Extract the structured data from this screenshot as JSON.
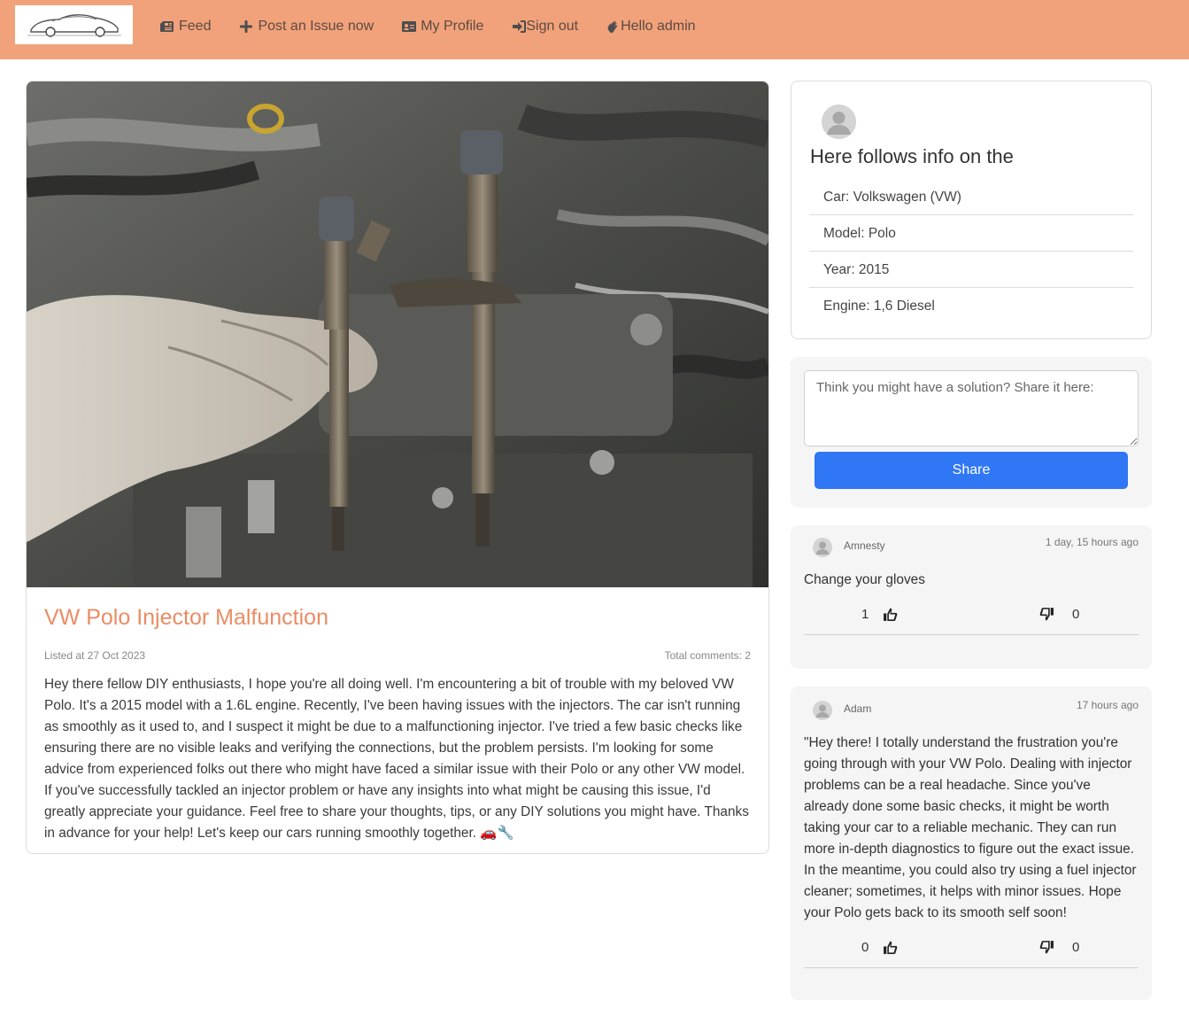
{
  "nav": {
    "links": [
      {
        "label": "Feed",
        "icon": "newspaper-icon"
      },
      {
        "label": "Post an Issue now",
        "icon": "plus-icon"
      },
      {
        "label": "My Profile",
        "icon": "id-card-icon"
      },
      {
        "label": "Sign out",
        "icon": "sign-out-icon"
      },
      {
        "label": "Hello admin",
        "icon": "waving-hand-icon"
      }
    ]
  },
  "post": {
    "title": "VW Polo Injector Malfunction",
    "listed_at": "Listed at 27 Oct 2023",
    "total_comments": "Total comments: 2",
    "body": "Hey there fellow DIY enthusiasts, I hope you're all doing well. I'm encountering a bit of trouble with my beloved VW Polo. It's a 2015 model with a 1.6L engine. Recently, I've been having issues with the injectors. The car isn't running as smoothly as it used to, and I suspect it might be due to a malfunctioning injector. I've tried a few basic checks like ensuring there are no visible leaks and verifying the connections, but the problem persists. I'm looking for some advice from experienced folks out there who might have faced a similar issue with their Polo or any other VW model. If you've successfully tackled an injector problem or have any insights into what might be causing this issue, I'd greatly appreciate your guidance. Feel free to share your thoughts, tips, or any DIY solutions you might have. Thanks in advance for your help! Let's keep our cars running smoothly together. 🚗🔧"
  },
  "info": {
    "heading": "Here follows info on the",
    "car": "Car: Volkswagen (VW)",
    "model": "Model: Polo",
    "year": "Year: 2015",
    "engine": "Engine: 1,6 Diesel"
  },
  "share": {
    "placeholder": "Think you might have a solution? Share it here:",
    "button_label": "Share"
  },
  "comments": [
    {
      "author": "Amnesty",
      "time": "1 day, 15 hours ago",
      "text": "Change your gloves",
      "upvotes": "1",
      "downvotes": "0"
    },
    {
      "author": "Adam",
      "time": "17 hours ago",
      "text": "\"Hey there! I totally understand the frustration you're going through with your VW Polo. Dealing with injector problems can be a real headache. Since you've already done some basic checks, it might be worth taking your car to a reliable mechanic. They can run more in-depth diagnostics to figure out the exact issue. In the meantime, you could also try using a fuel injector cleaner; sometimes, it helps with minor issues. Hope your Polo gets back to its smooth self soon!",
      "upvotes": "0",
      "downvotes": "0"
    }
  ],
  "colors": {
    "navbar": "#f2a27a",
    "title": "#ea8c63",
    "share_button": "#2f77f5"
  }
}
